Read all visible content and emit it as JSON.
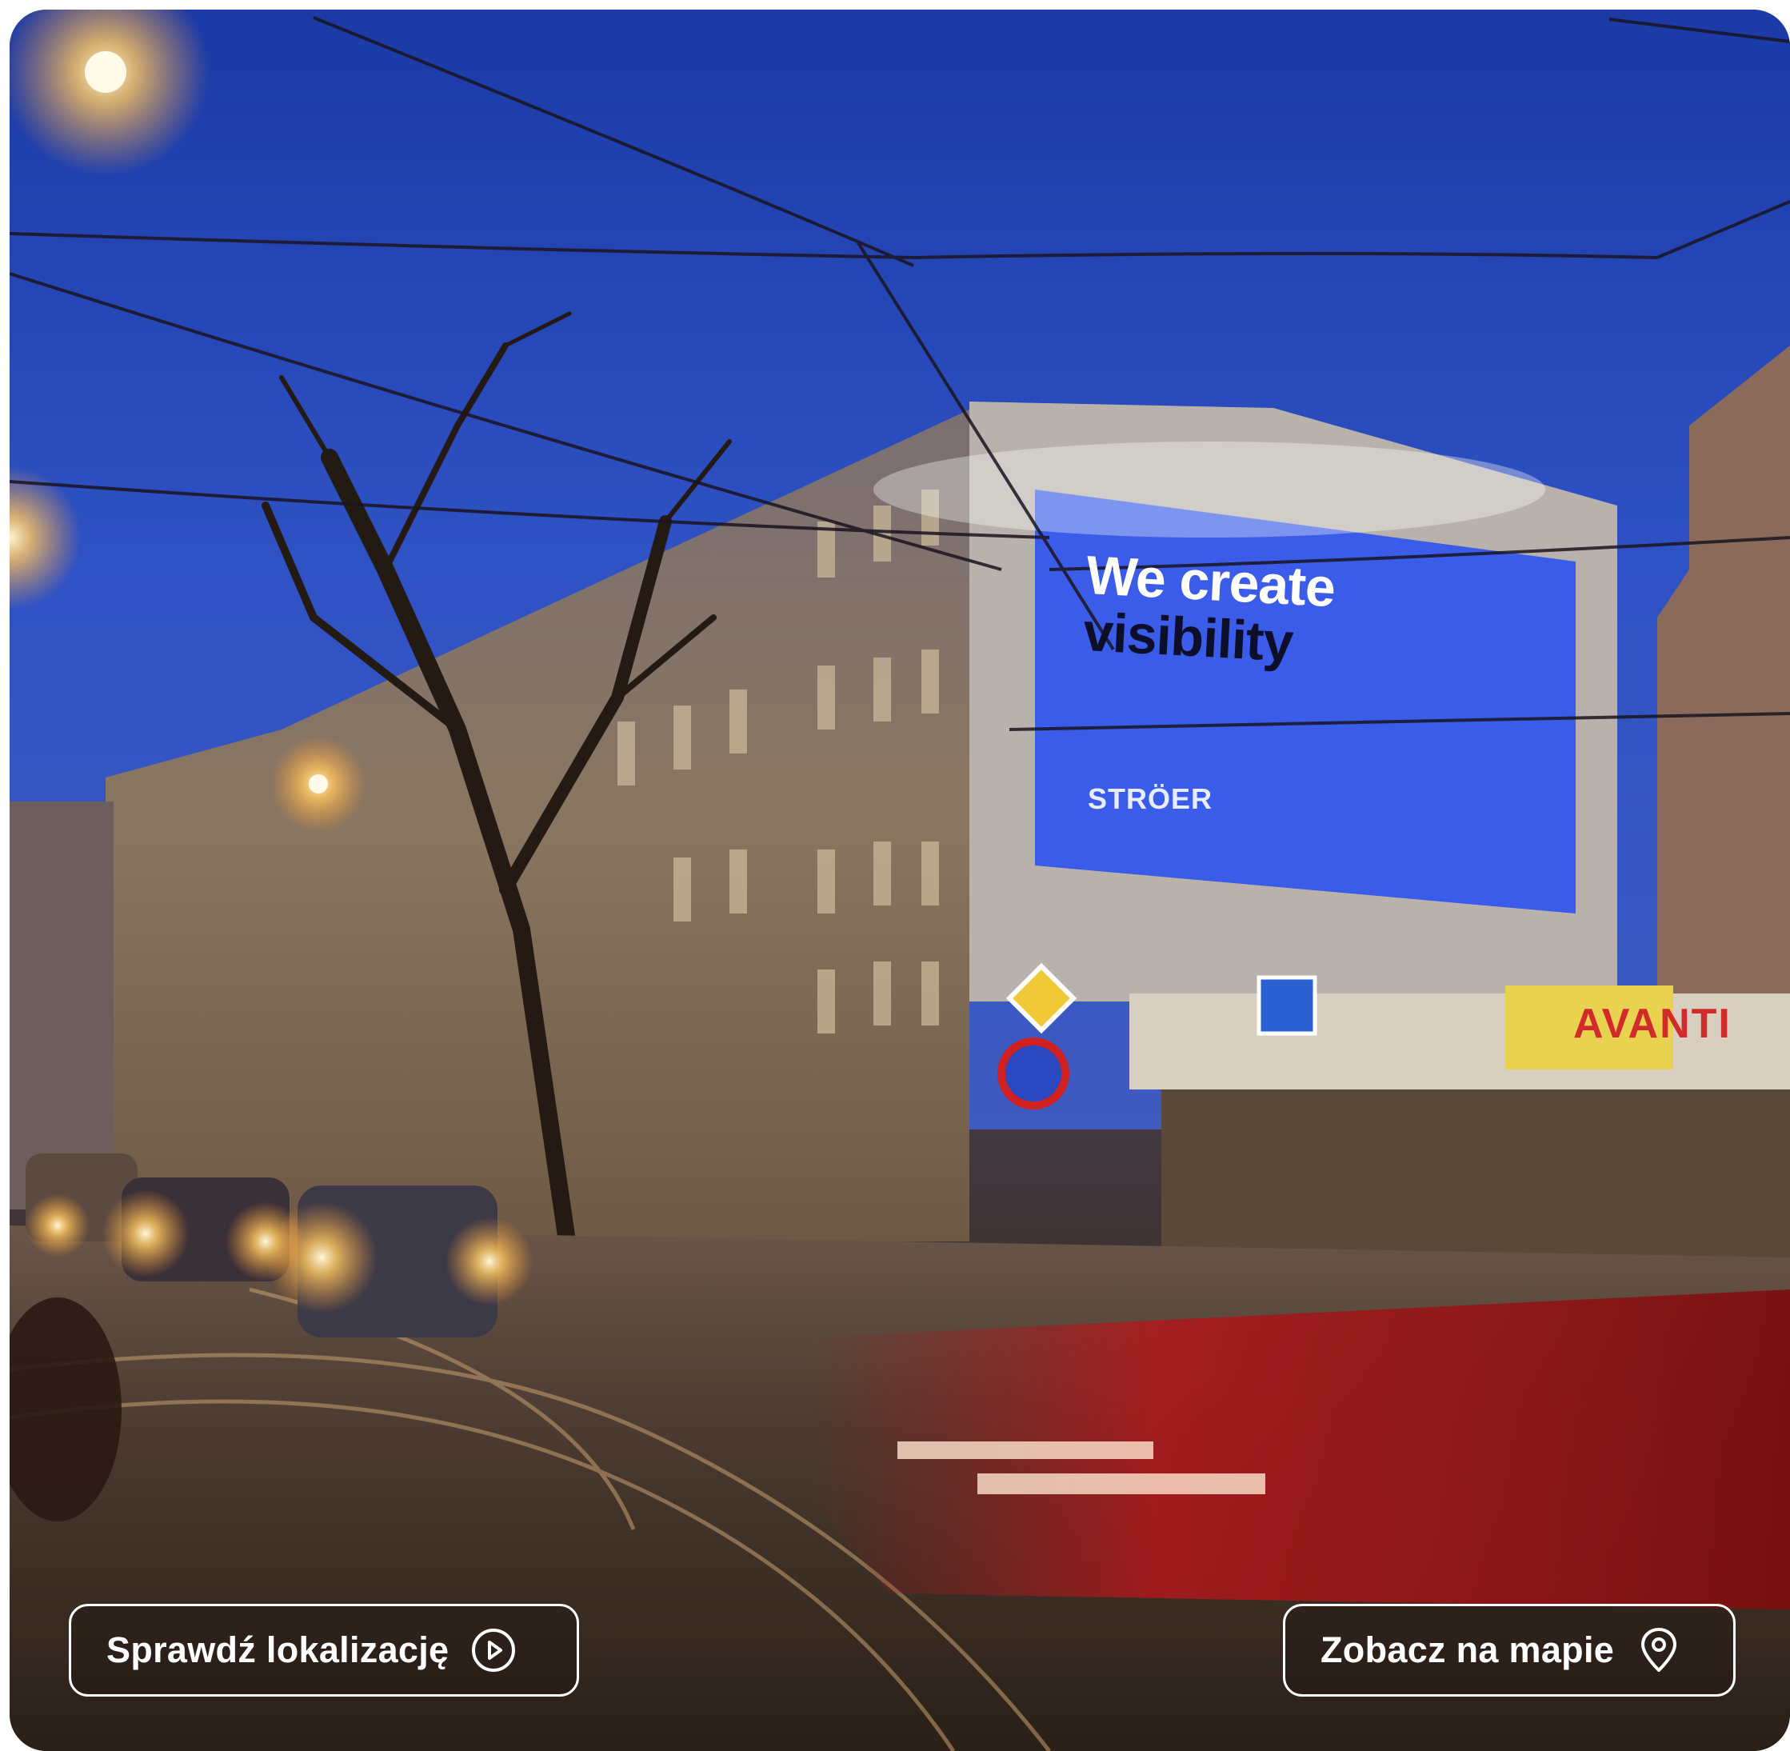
{
  "card": {
    "billboard": {
      "headline_line1": "We create",
      "headline_line2": "visibility",
      "brand": "STRÖER"
    },
    "shop_sign": "AVANTI",
    "buttons": {
      "check_location": {
        "label": "Sprawdź lokalizację",
        "icon": "play-circle-icon"
      },
      "view_on_map": {
        "label": "Zobacz na mapie",
        "icon": "map-pin-icon"
      }
    }
  },
  "colors": {
    "sky": "#2a4fc0",
    "billboard": "#3a5ce8",
    "button_border": "#ffffff",
    "button_text": "#ffffff"
  }
}
